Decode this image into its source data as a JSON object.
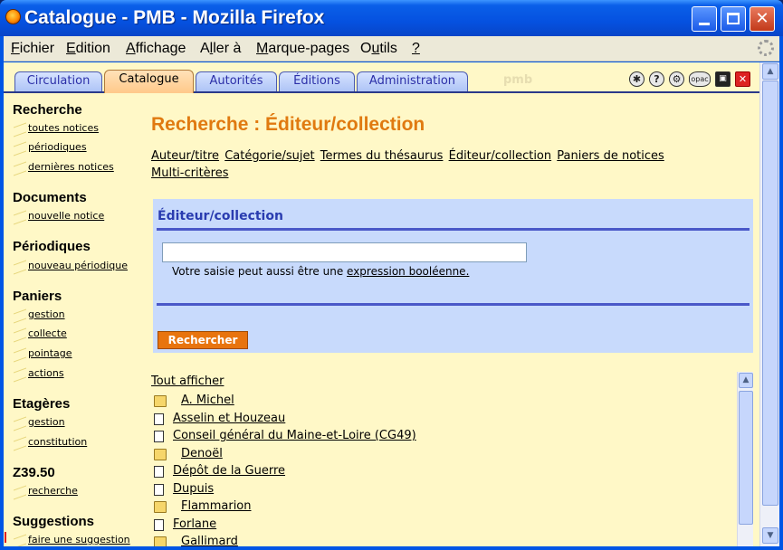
{
  "window": {
    "title": "Catalogue - PMB - Mozilla Firefox"
  },
  "menubar": {
    "items": [
      {
        "pre": "",
        "ul": "F",
        "post": "ichier"
      },
      {
        "pre": "",
        "ul": "E",
        "post": "dition"
      },
      {
        "pre": "",
        "ul": "A",
        "post": "ffichage"
      },
      {
        "pre": "A",
        "ul": "l",
        "post": "ler à"
      },
      {
        "pre": "",
        "ul": "M",
        "post": "arque-pages"
      },
      {
        "pre": "O",
        "ul": "u",
        "post": "tils"
      },
      {
        "pre": "",
        "ul": "?",
        "post": ""
      }
    ]
  },
  "tabs": [
    "Circulation",
    "Catalogue",
    "Autorités",
    "Éditions",
    "Administration"
  ],
  "tabs_ghost": "pmb",
  "toolbar_icons": [
    "globe-icon",
    "help-icon",
    "gear-icon",
    "opac-icon",
    "save-icon",
    "close-icon"
  ],
  "toolbar_opac_label": "opac",
  "sidebar": {
    "recherche": {
      "title": "Recherche",
      "links": [
        "toutes notices",
        "périodiques",
        "dernières notices"
      ]
    },
    "documents": {
      "title": "Documents",
      "links": [
        "nouvelle notice"
      ]
    },
    "periodiques": {
      "title": "Périodiques",
      "links": [
        "nouveau périodique"
      ]
    },
    "paniers": {
      "title": "Paniers",
      "links": [
        "gestion",
        "collecte",
        "pointage",
        "actions"
      ]
    },
    "etageres": {
      "title": "Etagères",
      "links": [
        "gestion",
        "constitution"
      ]
    },
    "z3950": {
      "title": "Z39.50",
      "links": [
        "recherche"
      ]
    },
    "suggestions": {
      "title": "Suggestions",
      "links": [
        "faire une suggestion"
      ]
    }
  },
  "main": {
    "title": "Recherche : Éditeur/collection",
    "subnav": [
      "Auteur/titre",
      "Catégorie/sujet",
      "Termes du thésaurus",
      "Éditeur/collection",
      "Paniers de notices",
      "Multi-critères"
    ],
    "panel_title": "Éditeur/collection",
    "search_value": "",
    "hint_prefix": "Votre saisie peut aussi être une",
    "hint_link": "expression booléenne.",
    "search_button": "Rechercher",
    "all_link": "Tout afficher",
    "results": [
      {
        "type": "folder",
        "label": "A. Michel"
      },
      {
        "type": "doc",
        "label": "Asselin et Houzeau"
      },
      {
        "type": "doc",
        "label": "Conseil général du Maine-et-Loire (CG49)"
      },
      {
        "type": "folder",
        "label": "Denoël"
      },
      {
        "type": "doc",
        "label": "Dépôt de la Guerre"
      },
      {
        "type": "doc",
        "label": "Dupuis"
      },
      {
        "type": "folder",
        "label": "Flammarion"
      },
      {
        "type": "doc",
        "label": "Forlane"
      },
      {
        "type": "folder",
        "label": "Gallimard"
      }
    ]
  },
  "colors": {
    "accent_title": "#e07a10",
    "panel_bg": "#c8dafc",
    "content_bg": "#fff8c7",
    "button": "#e8740e"
  }
}
